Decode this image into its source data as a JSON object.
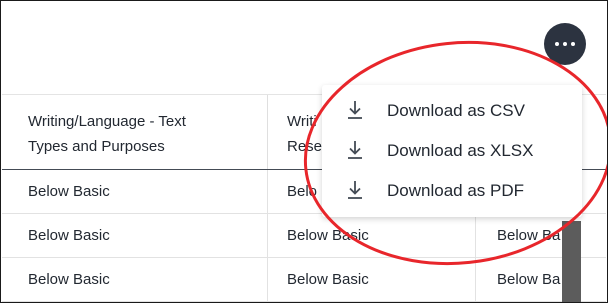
{
  "header": {
    "more_button_icon": "more-horizontal-icon"
  },
  "table": {
    "columns": [
      {
        "label_line1": "Writing/Language - Text",
        "label_line2": "Types and Purposes"
      },
      {
        "label_line1": "Writi",
        "label_line2": "Rese"
      }
    ],
    "rows": [
      {
        "c1": "Below Basic",
        "c2": "Belo",
        "c3": ""
      },
      {
        "c1": "Below Basic",
        "c2": "Below Basic",
        "c3": "Below Ba"
      },
      {
        "c1": "Below Basic",
        "c2": "Below Basic",
        "c3": "Below Ba"
      }
    ]
  },
  "menu": {
    "items": [
      {
        "label": "Download as CSV",
        "icon": "download-icon"
      },
      {
        "label": "Download as XLSX",
        "icon": "download-icon"
      },
      {
        "label": "Download as PDF",
        "icon": "download-icon"
      }
    ]
  },
  "colors": {
    "annotation": "#e8262b",
    "button_bg": "#2c3340",
    "text": "#222831"
  }
}
